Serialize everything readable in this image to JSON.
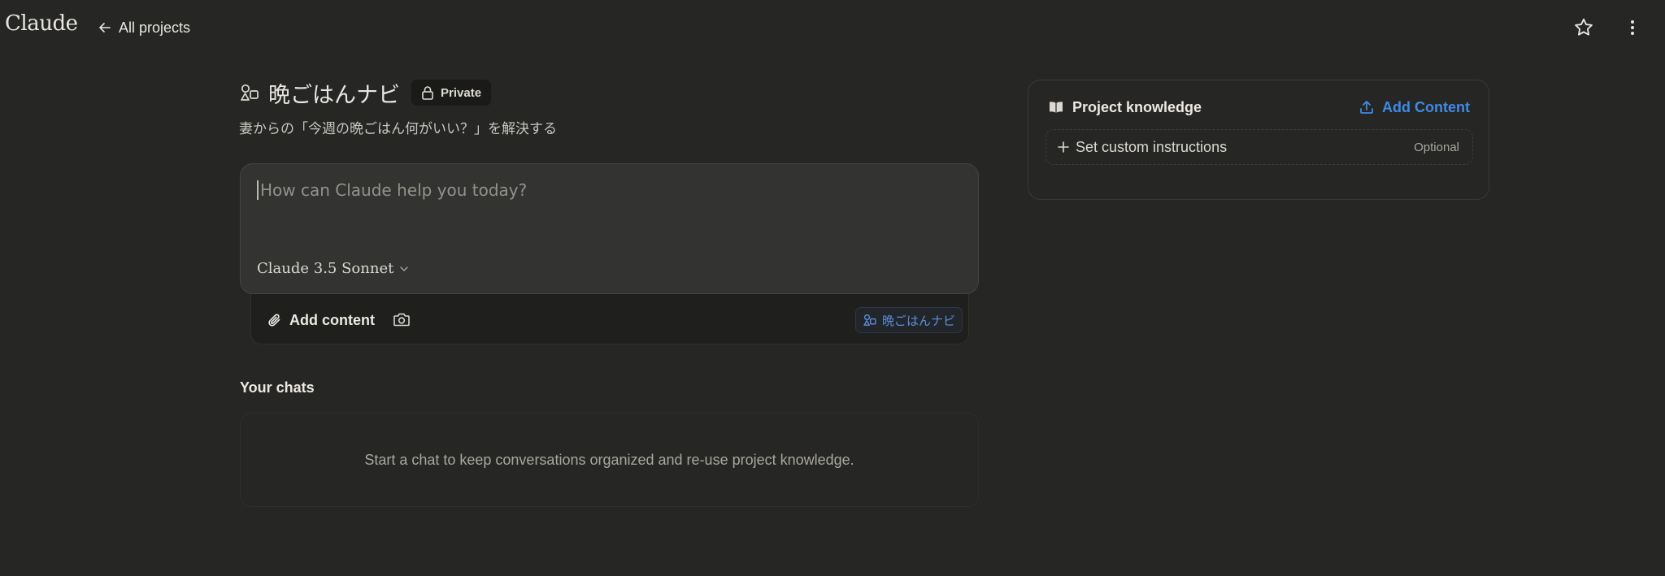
{
  "brand": "Claude",
  "nav": {
    "back_label": "All projects"
  },
  "icons": {
    "back": "arrow-left-icon",
    "star": "star-icon",
    "more": "more-vertical-icon",
    "project": "project-shapes-icon",
    "lock": "lock-icon",
    "paperclip": "paperclip-icon",
    "camera": "camera-icon",
    "chevron": "chevron-down-icon",
    "book": "book-open-icon",
    "upload": "upload-icon",
    "plus": "plus-icon"
  },
  "project": {
    "name": "晩ごはんナビ",
    "visibility": "Private",
    "description": "妻からの「今週の晩ごはん何がいい？」を解決する"
  },
  "composer": {
    "placeholder": "How can Claude help you today?",
    "model": "Claude 3.5 Sonnet",
    "add_content_label": "Add content",
    "project_chip": "晩ごはんナビ"
  },
  "chats": {
    "heading": "Your chats",
    "empty_message": "Start a chat to keep conversations organized and re-use project knowledge."
  },
  "knowledge": {
    "title": "Project knowledge",
    "add_label": "Add Content",
    "instructions_label": "Set custom instructions",
    "instructions_hint": "Optional"
  },
  "colors": {
    "background": "#262624",
    "composer": "#333331",
    "accent_blue": "#3f8ae6",
    "text": "#e8e6e1"
  }
}
